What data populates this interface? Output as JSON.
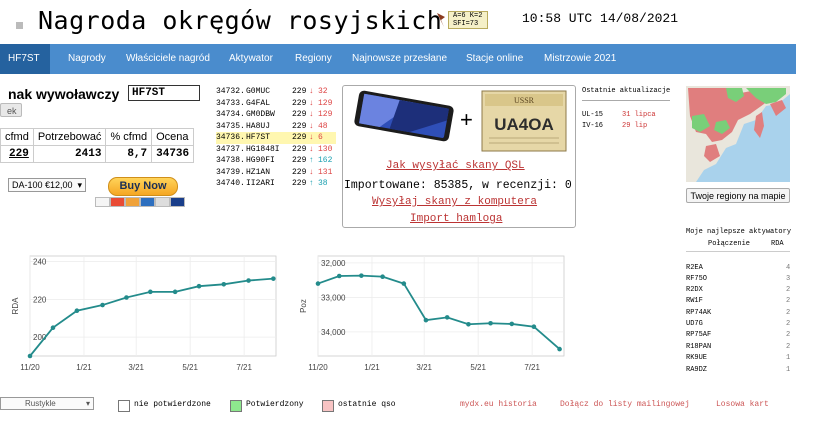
{
  "header": {
    "title": "Nagroda okręgów rosyjskich",
    "solar": {
      "line1": "A=6  K=2",
      "line2": "SFI=73"
    },
    "clock": "10:58 UTC 14/08/2021"
  },
  "nav": {
    "items": [
      "HF7ST",
      "Nagrody",
      "Właściciele nagród",
      "Aktywator",
      "Regiony",
      "Najnowsze przesłane",
      "Stacje online",
      "Mistrzowie 2021"
    ]
  },
  "callsign": {
    "label": "nak wywoławczy",
    "value": "HF7ST",
    "check_label": "ek"
  },
  "stats": {
    "headers": [
      "cfmd",
      "Potrzebować",
      "% cfmd",
      "Ocena"
    ],
    "values": [
      "229",
      "2413",
      "8,7",
      "34736"
    ]
  },
  "purchase": {
    "option": "DA-100 €12,00",
    "buy_label": "Buy Now"
  },
  "latest": [
    {
      "num": "34732.",
      "call": "G0MUC",
      "total": "229",
      "delta": "32"
    },
    {
      "num": "34733.",
      "call": "G4FAL",
      "total": "229",
      "delta": "129"
    },
    {
      "num": "34734.",
      "call": "GM0DBW",
      "total": "229",
      "delta": "129"
    },
    {
      "num": "34735.",
      "call": "HA8UJ",
      "total": "229",
      "delta": "48"
    },
    {
      "num": "34736.",
      "call": "HF7ST",
      "total": "229",
      "delta": "6"
    },
    {
      "num": "34737.",
      "call": "HG1848I",
      "total": "229",
      "delta": "130"
    },
    {
      "num": "34738.",
      "call": "HG90FI",
      "total": "229",
      "delta": "162"
    },
    {
      "num": "34739.",
      "call": "HZ1AN",
      "total": "229",
      "delta": "131"
    },
    {
      "num": "34740.",
      "call": "II2ARI",
      "total": "229",
      "delta": "38"
    }
  ],
  "promo": {
    "qsl_call": "UA4OA",
    "qsl_head": "USSR",
    "plus": "+",
    "link_how": "Jak wysyłać skany QSL",
    "imported": "Importowane: 85385, w recenzji: 0",
    "link_upload": "Wysyłaj skany z komputera",
    "link_import": "Import hamloga"
  },
  "updates": {
    "title": "Ostatnie aktualizacje",
    "rows": [
      {
        "call": "UL-15",
        "date": "31 lipca"
      },
      {
        "call": "IV-16",
        "date": "29 lip"
      }
    ]
  },
  "map": {
    "button": "Twoje regiony na mapie"
  },
  "top_activators": {
    "title": "Moje najlepsze aktywatory",
    "col_conn": "Połączenie",
    "col_rda": "RDA",
    "rows": [
      {
        "call": "R2EA",
        "rda": "4"
      },
      {
        "call": "RF75O",
        "rda": "3"
      },
      {
        "call": "R2DX",
        "rda": "2"
      },
      {
        "call": "RW1F",
        "rda": "2"
      },
      {
        "call": "RP74AK",
        "rda": "2"
      },
      {
        "call": "UD7G",
        "rda": "2"
      },
      {
        "call": "RP75AF",
        "rda": "2"
      },
      {
        "call": "R18PAN",
        "rda": "2"
      },
      {
        "call": "RK9UE",
        "rda": "1"
      },
      {
        "call": "RA9DZ",
        "rda": "1"
      }
    ]
  },
  "chart_data": [
    {
      "type": "line",
      "ylabel": "RDA",
      "xticks": [
        "11/20",
        "1/21",
        "3/21",
        "5/21",
        "7/21"
      ],
      "yticks": [
        "200",
        "220",
        "240"
      ],
      "ylim": [
        190,
        243
      ],
      "x": [
        "2020-11-01",
        "2020-11-27",
        "2020-12-24",
        "2021-01-22",
        "2021-02-18",
        "2021-03-17",
        "2021-04-14",
        "2021-05-11",
        "2021-06-08",
        "2021-07-06",
        "2021-08-03"
      ],
      "values": [
        190,
        205,
        214,
        217,
        221,
        224,
        224,
        227,
        228,
        230,
        231
      ],
      "color": "#238b8b"
    },
    {
      "type": "line",
      "ylabel": "Poz",
      "xticks": [
        "11/20",
        "1/21",
        "3/21",
        "5/21",
        "7/21"
      ],
      "yticks": [
        "32,000",
        "33,000",
        "34,000"
      ],
      "ylim": [
        34700,
        31800
      ],
      "x": [
        "2020-11-01",
        "2020-11-25",
        "2020-12-20",
        "2021-01-13",
        "2021-02-06",
        "2021-03-03",
        "2021-03-27",
        "2021-04-20",
        "2021-05-15",
        "2021-06-08",
        "2021-07-03",
        "2021-08-01"
      ],
      "values": [
        32600,
        32380,
        32370,
        32400,
        32600,
        33660,
        33580,
        33780,
        33750,
        33770,
        33850,
        34500
      ],
      "color": "#238b8b"
    }
  ],
  "legend": {
    "select": "Rustykle",
    "items": [
      {
        "label": "nie potwierdzone",
        "color": "#ffffff"
      },
      {
        "label": "Potwierdzony",
        "color": "#8ee88e"
      },
      {
        "label": "ostatnie qso",
        "color": "#f7c3c3"
      }
    ],
    "links": [
      "mydx.eu historia",
      "Dołącz do listy mailingowej",
      "Losowa karta"
    ]
  }
}
